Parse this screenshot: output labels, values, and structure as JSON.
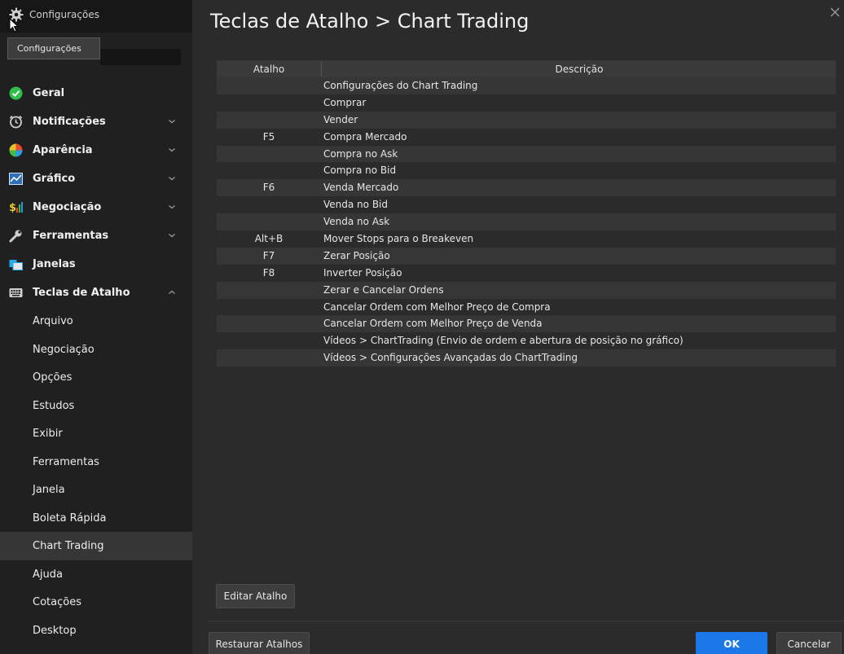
{
  "window": {
    "title": "Configurações",
    "tooltip": "Configurações"
  },
  "sidebar": {
    "items": [
      {
        "label": "Geral",
        "icon": "check-circle-icon",
        "color": "#2fbf4a",
        "chevron": ""
      },
      {
        "label": "Notificações",
        "icon": "alarm-clock-icon",
        "color": "#cfcfcf",
        "chevron": "down"
      },
      {
        "label": "Aparência",
        "icon": "palette-icon",
        "color": "#e8742a",
        "chevron": "down"
      },
      {
        "label": "Gráfico",
        "icon": "chart-line-icon",
        "color": "#3d8fe0",
        "chevron": "down"
      },
      {
        "label": "Negociação",
        "icon": "dollar-bars-icon",
        "color": "#e8c82a",
        "chevron": "down"
      },
      {
        "label": "Ferramentas",
        "icon": "wrench-icon",
        "color": "#cfcfcf",
        "chevron": "down"
      },
      {
        "label": "Janelas",
        "icon": "windows-icon",
        "color": "#2aa8e8",
        "chevron": ""
      },
      {
        "label": "Teclas de Atalho",
        "icon": "keyboard-icon",
        "color": "#cfcfcf",
        "chevron": "up"
      }
    ],
    "subitems": [
      {
        "label": "Arquivo",
        "active": false
      },
      {
        "label": "Negociação",
        "active": false
      },
      {
        "label": "Opções",
        "active": false
      },
      {
        "label": "Estudos",
        "active": false
      },
      {
        "label": "Exibir",
        "active": false
      },
      {
        "label": "Ferramentas",
        "active": false
      },
      {
        "label": "Janela",
        "active": false
      },
      {
        "label": "Boleta Rápida",
        "active": false
      },
      {
        "label": "Chart Trading",
        "active": true
      },
      {
        "label": "Ajuda",
        "active": false
      },
      {
        "label": "Cotações",
        "active": false
      },
      {
        "label": "Desktop",
        "active": false
      }
    ]
  },
  "main": {
    "title": "Teclas de Atalho > Chart Trading",
    "table": {
      "headers": {
        "key": "Atalho",
        "desc": "Descrição"
      },
      "rows": [
        {
          "key": "",
          "desc": "Configurações do Chart Trading"
        },
        {
          "key": "",
          "desc": "Comprar"
        },
        {
          "key": "",
          "desc": "Vender"
        },
        {
          "key": "F5",
          "desc": "Compra Mercado"
        },
        {
          "key": "",
          "desc": "Compra no Ask"
        },
        {
          "key": "",
          "desc": "Compra no Bid"
        },
        {
          "key": "F6",
          "desc": "Venda Mercado"
        },
        {
          "key": "",
          "desc": "Venda no Bid"
        },
        {
          "key": "",
          "desc": "Venda no Ask"
        },
        {
          "key": "Alt+B",
          "desc": "Mover Stops para o Breakeven"
        },
        {
          "key": "F7",
          "desc": "Zerar Posição"
        },
        {
          "key": "F8",
          "desc": "Inverter Posição"
        },
        {
          "key": "",
          "desc": "Zerar e Cancelar Ordens"
        },
        {
          "key": "",
          "desc": "Cancelar Ordem com Melhor Preço de Compra"
        },
        {
          "key": "",
          "desc": "Cancelar Ordem com Melhor Preço de Venda"
        },
        {
          "key": "",
          "desc": "Vídeos  >  ChartTrading (Envio de ordem e abertura de posição no gráfico)"
        },
        {
          "key": "",
          "desc": "Vídeos  >  Configurações Avançadas do ChartTrading"
        }
      ]
    },
    "buttons": {
      "edit": "Editar Atalho",
      "restore": "Restaurar Atalhos",
      "ok": "OK",
      "cancel": "Cancelar"
    }
  },
  "colors": {
    "accent": "#1a78e8",
    "background": "#2b2b2b",
    "sidebar": "#202020"
  }
}
